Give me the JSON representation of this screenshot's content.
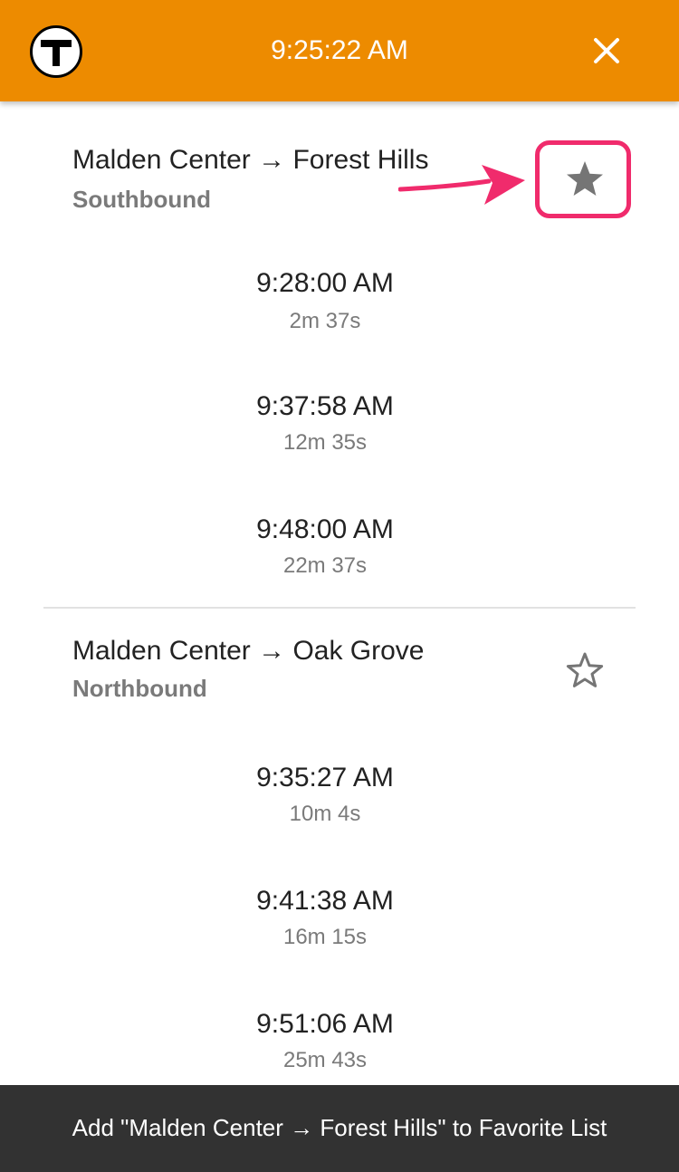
{
  "header": {
    "clock": "9:25:22 AM",
    "brand_color": "#ED8B00"
  },
  "routes": [
    {
      "name": "Malden Center → Forest Hills",
      "direction": "Southbound",
      "favorite": true,
      "star_icon": "filled-star-icon",
      "arrivals": [
        {
          "time": "9:28:00 AM",
          "countdown": "2m 37s"
        },
        {
          "time": "9:37:58 AM",
          "countdown": "12m 35s"
        },
        {
          "time": "9:48:00 AM",
          "countdown": "22m 37s"
        }
      ]
    },
    {
      "name": "Malden Center → Oak Grove",
      "direction": "Northbound",
      "favorite": false,
      "star_icon": "outline-star-icon",
      "arrivals": [
        {
          "time": "9:35:27 AM",
          "countdown": "10m 4s"
        },
        {
          "time": "9:41:38 AM",
          "countdown": "16m 15s"
        },
        {
          "time": "9:51:06 AM",
          "countdown": "25m 43s"
        }
      ]
    }
  ],
  "snackbar": {
    "message": "Add \"Malden Center → Forest Hills\" to Favorite List"
  },
  "annotation": {
    "highlight_color": "#F02B6C"
  }
}
